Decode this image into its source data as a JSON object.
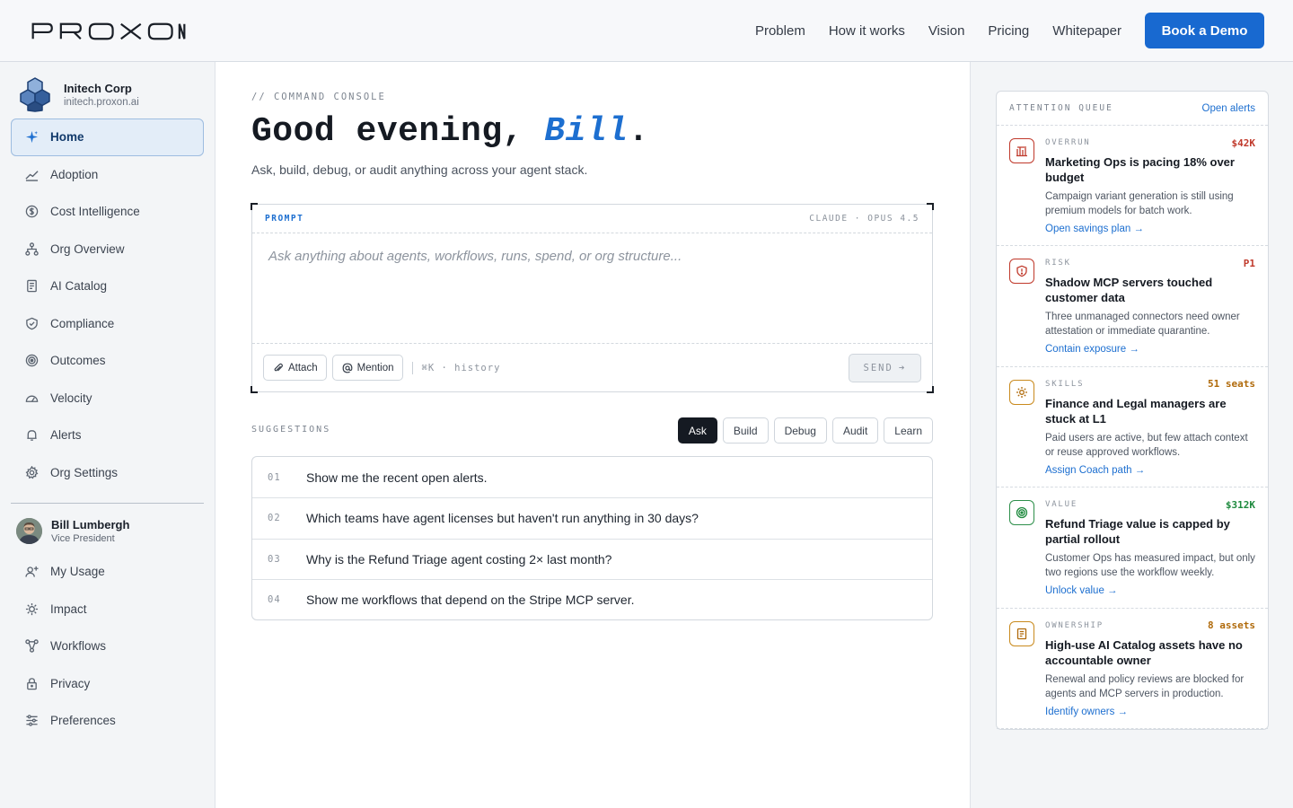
{
  "brand": {
    "logo_text": "PROXON"
  },
  "nav": {
    "items": [
      "Problem",
      "How it works",
      "Vision",
      "Pricing",
      "Whitepaper"
    ],
    "cta": "Book a Demo"
  },
  "org": {
    "name": "Initech Corp",
    "domain": "initech.proxon.ai"
  },
  "sidebar": {
    "items": [
      {
        "label": "Home",
        "icon": "sparkle-icon"
      },
      {
        "label": "Adoption",
        "icon": "trend-icon"
      },
      {
        "label": "Cost Intelligence",
        "icon": "dollar-icon"
      },
      {
        "label": "Org Overview",
        "icon": "org-chart-icon"
      },
      {
        "label": "AI Catalog",
        "icon": "book-icon"
      },
      {
        "label": "Compliance",
        "icon": "shield-icon"
      },
      {
        "label": "Outcomes",
        "icon": "target-icon"
      },
      {
        "label": "Velocity",
        "icon": "gauge-icon"
      },
      {
        "label": "Alerts",
        "icon": "bell-icon"
      },
      {
        "label": "Org Settings",
        "icon": "gear-icon"
      }
    ],
    "active": "Home"
  },
  "user": {
    "name": "Bill Lumbergh",
    "role": "Vice President"
  },
  "user_menu": {
    "items": [
      {
        "label": "My Usage",
        "icon": "user-plus-icon"
      },
      {
        "label": "Impact",
        "icon": "cog-icon"
      },
      {
        "label": "Workflows",
        "icon": "workflow-icon"
      },
      {
        "label": "Privacy",
        "icon": "lock-icon"
      },
      {
        "label": "Preferences",
        "icon": "sliders-icon"
      }
    ]
  },
  "main": {
    "eyebrow": "// COMMAND CONSOLE",
    "greeting_prefix": "Good evening,",
    "greeting_name": "Bill",
    "greeting_suffix": ".",
    "subtitle": "Ask, build, debug, or audit anything across your agent stack."
  },
  "prompt": {
    "label": "PROMPT",
    "model": "CLAUDE · OPUS 4.5",
    "placeholder": "Ask anything about agents, workflows, runs, spend, or org structure...",
    "attach": "Attach",
    "mention": "Mention",
    "history_hint": "⌘K · history",
    "send": "SEND"
  },
  "suggestions": {
    "label": "SUGGESTIONS",
    "tabs": [
      "Ask",
      "Build",
      "Debug",
      "Audit",
      "Learn"
    ],
    "active_tab": "Ask",
    "rows": [
      {
        "num": "01",
        "text": "Show me the recent open alerts."
      },
      {
        "num": "02",
        "text": "Which teams have agent licenses but haven't run anything in 30 days?"
      },
      {
        "num": "03",
        "text": "Why is the Refund Triage agent costing 2× last month?"
      },
      {
        "num": "04",
        "text": "Show me workflows that depend on the Stripe MCP server."
      }
    ]
  },
  "attention": {
    "title": "ATTENTION QUEUE",
    "link": "Open alerts",
    "cards": [
      {
        "kind": "OVERRUN",
        "meta": "$42K",
        "tone": "red",
        "icon": "bar-chart-icon",
        "title": "Marketing Ops is pacing 18% over budget",
        "desc": "Campaign variant generation is still using premium models for batch work.",
        "action": "Open savings plan →"
      },
      {
        "kind": "RISK",
        "meta": "P1",
        "tone": "red",
        "icon": "shield-alert-icon",
        "title": "Shadow MCP servers touched customer data",
        "desc": "Three unmanaged connectors need owner attestation or immediate quarantine.",
        "action": "Contain exposure →"
      },
      {
        "kind": "SKILLS",
        "meta": "51 seats",
        "tone": "amber",
        "icon": "sun-icon",
        "title": "Finance and Legal managers are stuck at L1",
        "desc": "Paid users are active, but few attach context or reuse approved workflows.",
        "action": "Assign Coach path →"
      },
      {
        "kind": "VALUE",
        "meta": "$312K",
        "tone": "green",
        "icon": "target-icon",
        "title": "Refund Triage value is capped by partial rollout",
        "desc": "Customer Ops has measured impact, but only two regions use the workflow weekly.",
        "action": "Unlock value →"
      },
      {
        "kind": "OWNERSHIP",
        "meta": "8 assets",
        "tone": "amber",
        "icon": "book-icon",
        "title": "High-use AI Catalog assets have no accountable owner",
        "desc": "Renewal and policy reviews are blocked for agents and MCP servers in production.",
        "action": "Identify owners →"
      }
    ]
  },
  "colors": {
    "accent": "#1869d0",
    "danger": "#c0392b",
    "warning": "#b06a0a",
    "success": "#1e8a3e"
  }
}
